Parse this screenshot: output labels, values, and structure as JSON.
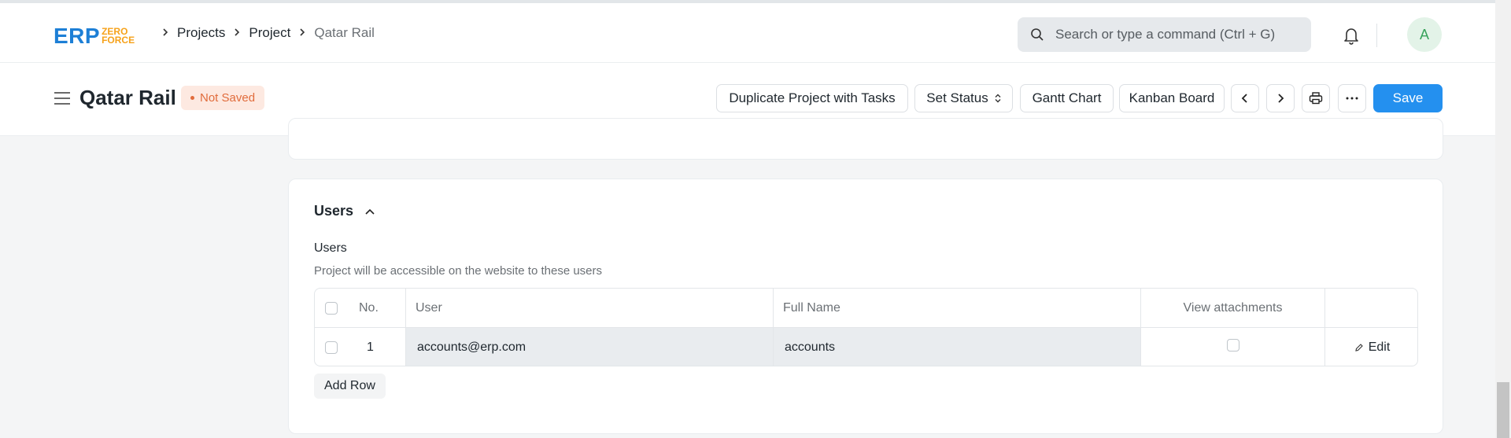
{
  "navbar": {
    "logo_main": "ERP",
    "logo_sub1": "ZERO",
    "logo_sub2": "FORCE",
    "breadcrumbs": [
      "Projects",
      "Project",
      "Qatar Rail"
    ],
    "search_placeholder": "Search or type a command (Ctrl + G)",
    "avatar_letter": "A"
  },
  "header": {
    "title": "Qatar Rail",
    "status_badge": "Not Saved",
    "buttons": {
      "duplicate": "Duplicate Project with Tasks",
      "set_status": "Set Status",
      "gantt": "Gantt Chart",
      "kanban": "Kanban Board",
      "save": "Save"
    }
  },
  "section": {
    "title": "Users",
    "field_label": "Users",
    "field_description": "Project will be accessible on the website to these users",
    "table": {
      "columns": [
        "No.",
        "User",
        "Full Name",
        "View attachments"
      ],
      "rows": [
        {
          "no": "1",
          "user": "accounts@erp.com",
          "full_name": "accounts",
          "view_attachments": false,
          "edit": "Edit"
        }
      ]
    },
    "add_row": "Add Row"
  },
  "colors": {
    "primary": "#2490ef",
    "badge_text": "#e16c3c",
    "badge_bg": "#fde9e1",
    "logo_blue": "#1d7fd6",
    "logo_orange": "#f6a21a"
  }
}
